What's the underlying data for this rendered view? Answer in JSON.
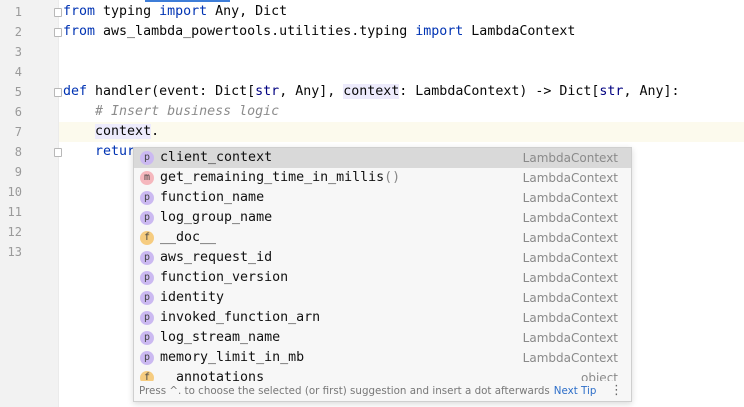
{
  "editor": {
    "line_numbers": [
      "1",
      "2",
      "3",
      "4",
      "5",
      "6",
      "7",
      "8",
      "9",
      "10",
      "11",
      "12",
      "13"
    ],
    "lines": [
      [
        {
          "t": "from",
          "c": "kw"
        },
        {
          "t": " typing "
        },
        {
          "t": "import",
          "c": "kw"
        },
        {
          "t": " Any, Dict"
        }
      ],
      [
        {
          "t": "from",
          "c": "kw"
        },
        {
          "t": " aws_lambda_powertools.utilities.typing "
        },
        {
          "t": "import",
          "c": "kw"
        },
        {
          "t": " LambdaContext"
        }
      ],
      [],
      [],
      [
        {
          "t": "def",
          "c": "kw"
        },
        {
          "t": " handler(event: Dict["
        },
        {
          "t": "str",
          "c": "bi"
        },
        {
          "t": ", Any], "
        },
        {
          "t": "context",
          "c": "hl"
        },
        {
          "t": ": LambdaContext) -> Dict["
        },
        {
          "t": "str",
          "c": "bi"
        },
        {
          "t": ", Any]:"
        }
      ],
      [
        {
          "t": "    "
        },
        {
          "t": "# Insert business logic",
          "c": "cm"
        }
      ],
      [
        {
          "t": "    "
        },
        {
          "t": "context",
          "c": "hl"
        },
        {
          "t": "."
        }
      ],
      [
        {
          "t": "    "
        },
        {
          "t": "retur",
          "c": "kw"
        }
      ]
    ]
  },
  "completion": {
    "items": [
      {
        "icon": "p",
        "name": "client_context",
        "type": "LambdaContext"
      },
      {
        "icon": "m",
        "name": "get_remaining_time_in_millis",
        "suffix": "()",
        "type": "LambdaContext"
      },
      {
        "icon": "p",
        "name": "function_name",
        "type": "LambdaContext"
      },
      {
        "icon": "p",
        "name": "log_group_name",
        "type": "LambdaContext"
      },
      {
        "icon": "f",
        "name": "__doc__",
        "type": "LambdaContext"
      },
      {
        "icon": "p",
        "name": "aws_request_id",
        "type": "LambdaContext"
      },
      {
        "icon": "p",
        "name": "function_version",
        "type": "LambdaContext"
      },
      {
        "icon": "p",
        "name": "identity",
        "type": "LambdaContext"
      },
      {
        "icon": "p",
        "name": "invoked_function_arn",
        "type": "LambdaContext"
      },
      {
        "icon": "p",
        "name": "log_stream_name",
        "type": "LambdaContext"
      },
      {
        "icon": "p",
        "name": "memory_limit_in_mb",
        "type": "LambdaContext"
      },
      {
        "icon": "f",
        "name": "__annotations__",
        "type": "object"
      }
    ],
    "selected_index": 0,
    "footer_text": "Press ^. to choose the selected (or first) suggestion and insert a dot afterwards",
    "next_tip_label": "Next Tip",
    "more_icon": "vertical-ellipsis"
  }
}
